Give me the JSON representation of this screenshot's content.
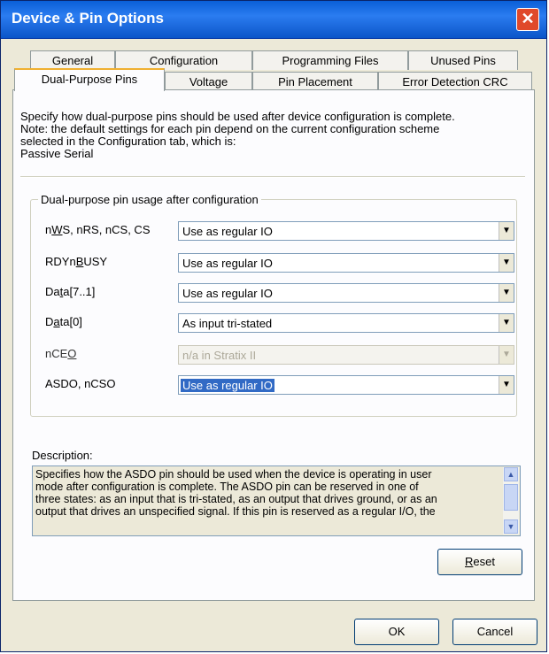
{
  "window": {
    "title": "Device & Pin Options",
    "close_glyph": "✕"
  },
  "tabs_back": [
    {
      "label": "General"
    },
    {
      "label": "Configuration"
    },
    {
      "label": "Programming Files"
    },
    {
      "label": "Unused Pins"
    }
  ],
  "tabs_front": [
    {
      "label": "Dual-Purpose Pins",
      "active": true
    },
    {
      "label": "Voltage"
    },
    {
      "label": "Pin Placement"
    },
    {
      "label": "Error Detection CRC"
    }
  ],
  "info": {
    "line1": "Specify how dual-purpose pins should be used after device configuration is complete.",
    "line2": "Note: the default settings for each pin depend on the current configuration scheme",
    "line3": "selected in the Configuration tab, which is:",
    "line4": "Passive Serial"
  },
  "group": {
    "title": "Dual-purpose pin usage after configuration"
  },
  "rows": [
    {
      "label_pre": "n",
      "label_u": "W",
      "label_post": "S, nRS, nCS, CS",
      "value": "Use as regular IO",
      "state": "normal"
    },
    {
      "label_pre": "RDYn",
      "label_u": "B",
      "label_post": "USY",
      "value": "Use as regular IO",
      "state": "normal"
    },
    {
      "label_pre": "Da",
      "label_u": "t",
      "label_post": "a[7..1]",
      "value": "Use as regular IO",
      "state": "normal"
    },
    {
      "label_pre": "D",
      "label_u": "a",
      "label_post": "ta[0]",
      "value": "As input tri-stated",
      "state": "normal"
    },
    {
      "label_pre": "nCE",
      "label_u": "O",
      "label_post": "",
      "value": "n/a in Stratix II",
      "state": "disabled"
    },
    {
      "label_pre": "ASDO, nCSO",
      "label_u": "",
      "label_post": "",
      "value": "Use as regular IO",
      "state": "selected"
    }
  ],
  "description": {
    "label": "Description:",
    "line1": "Specifies how the ASDO pin should be used when the device is operating in user",
    "line2": "mode after configuration is complete. The ASDO pin can be reserved in one of",
    "line3": "three states: as an input that is tri-stated, as an output that drives ground, or as an",
    "line4": "output that drives an unspecified signal. If this pin is reserved as a regular I/O, the"
  },
  "buttons": {
    "reset_u": "R",
    "reset_rest": "eset",
    "ok": "OK",
    "cancel": "Cancel"
  },
  "icons": {
    "dropdown": "chevron-down-icon",
    "scroll_up": "chevron-up-icon",
    "scroll_down": "chevron-down-icon",
    "close": "close-icon"
  }
}
